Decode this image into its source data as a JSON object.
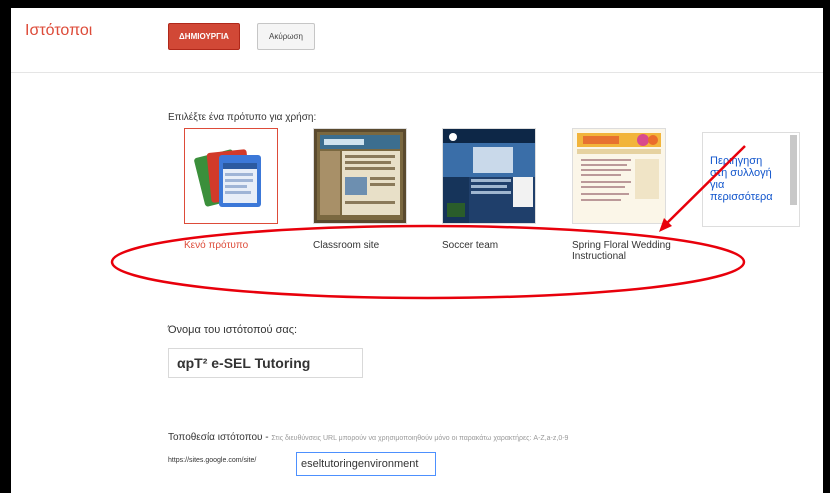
{
  "header": {
    "title": "Ιστότοποι",
    "create_label": "ΔΗΜΙΟΥΡΓΙΑ",
    "cancel_label": "Ακύρωση"
  },
  "templates": {
    "heading": "Επιλέξτε ένα πρότυπο για χρήση:",
    "items": [
      {
        "label": "Κενό πρότυπο",
        "icon": "blank-template-icon",
        "selected": true
      },
      {
        "label": "Classroom site",
        "icon": "classroom-site-thumbnail"
      },
      {
        "label": "Soccer team",
        "icon": "soccer-team-thumbnail"
      },
      {
        "label": "Spring Floral Wedding Instructional",
        "icon": "spring-floral-wedding-thumbnail"
      }
    ],
    "browse_link": "Περιήγηση στη συλλογή για περισσότερα"
  },
  "site_name": {
    "label": "Όνομα του ιστότοπού σας:",
    "value": "αpT² e-SEL Tutoring"
  },
  "site_location": {
    "label": "Τοποθεσία ιστότοπου",
    "separator": " - ",
    "hint": "Στις διευθύνσεις URL μπορούν να χρησιμοποιηθούν μόνο οι παρακάτω χαρακτήρες: A-Z,a-z,0-9",
    "url_prefix": "https://sites.google.com/site/",
    "value": "eseltutoringenvironment"
  },
  "colors": {
    "accent": "#dd4b39",
    "annotation": "#e8000b",
    "link": "#1155cc"
  }
}
